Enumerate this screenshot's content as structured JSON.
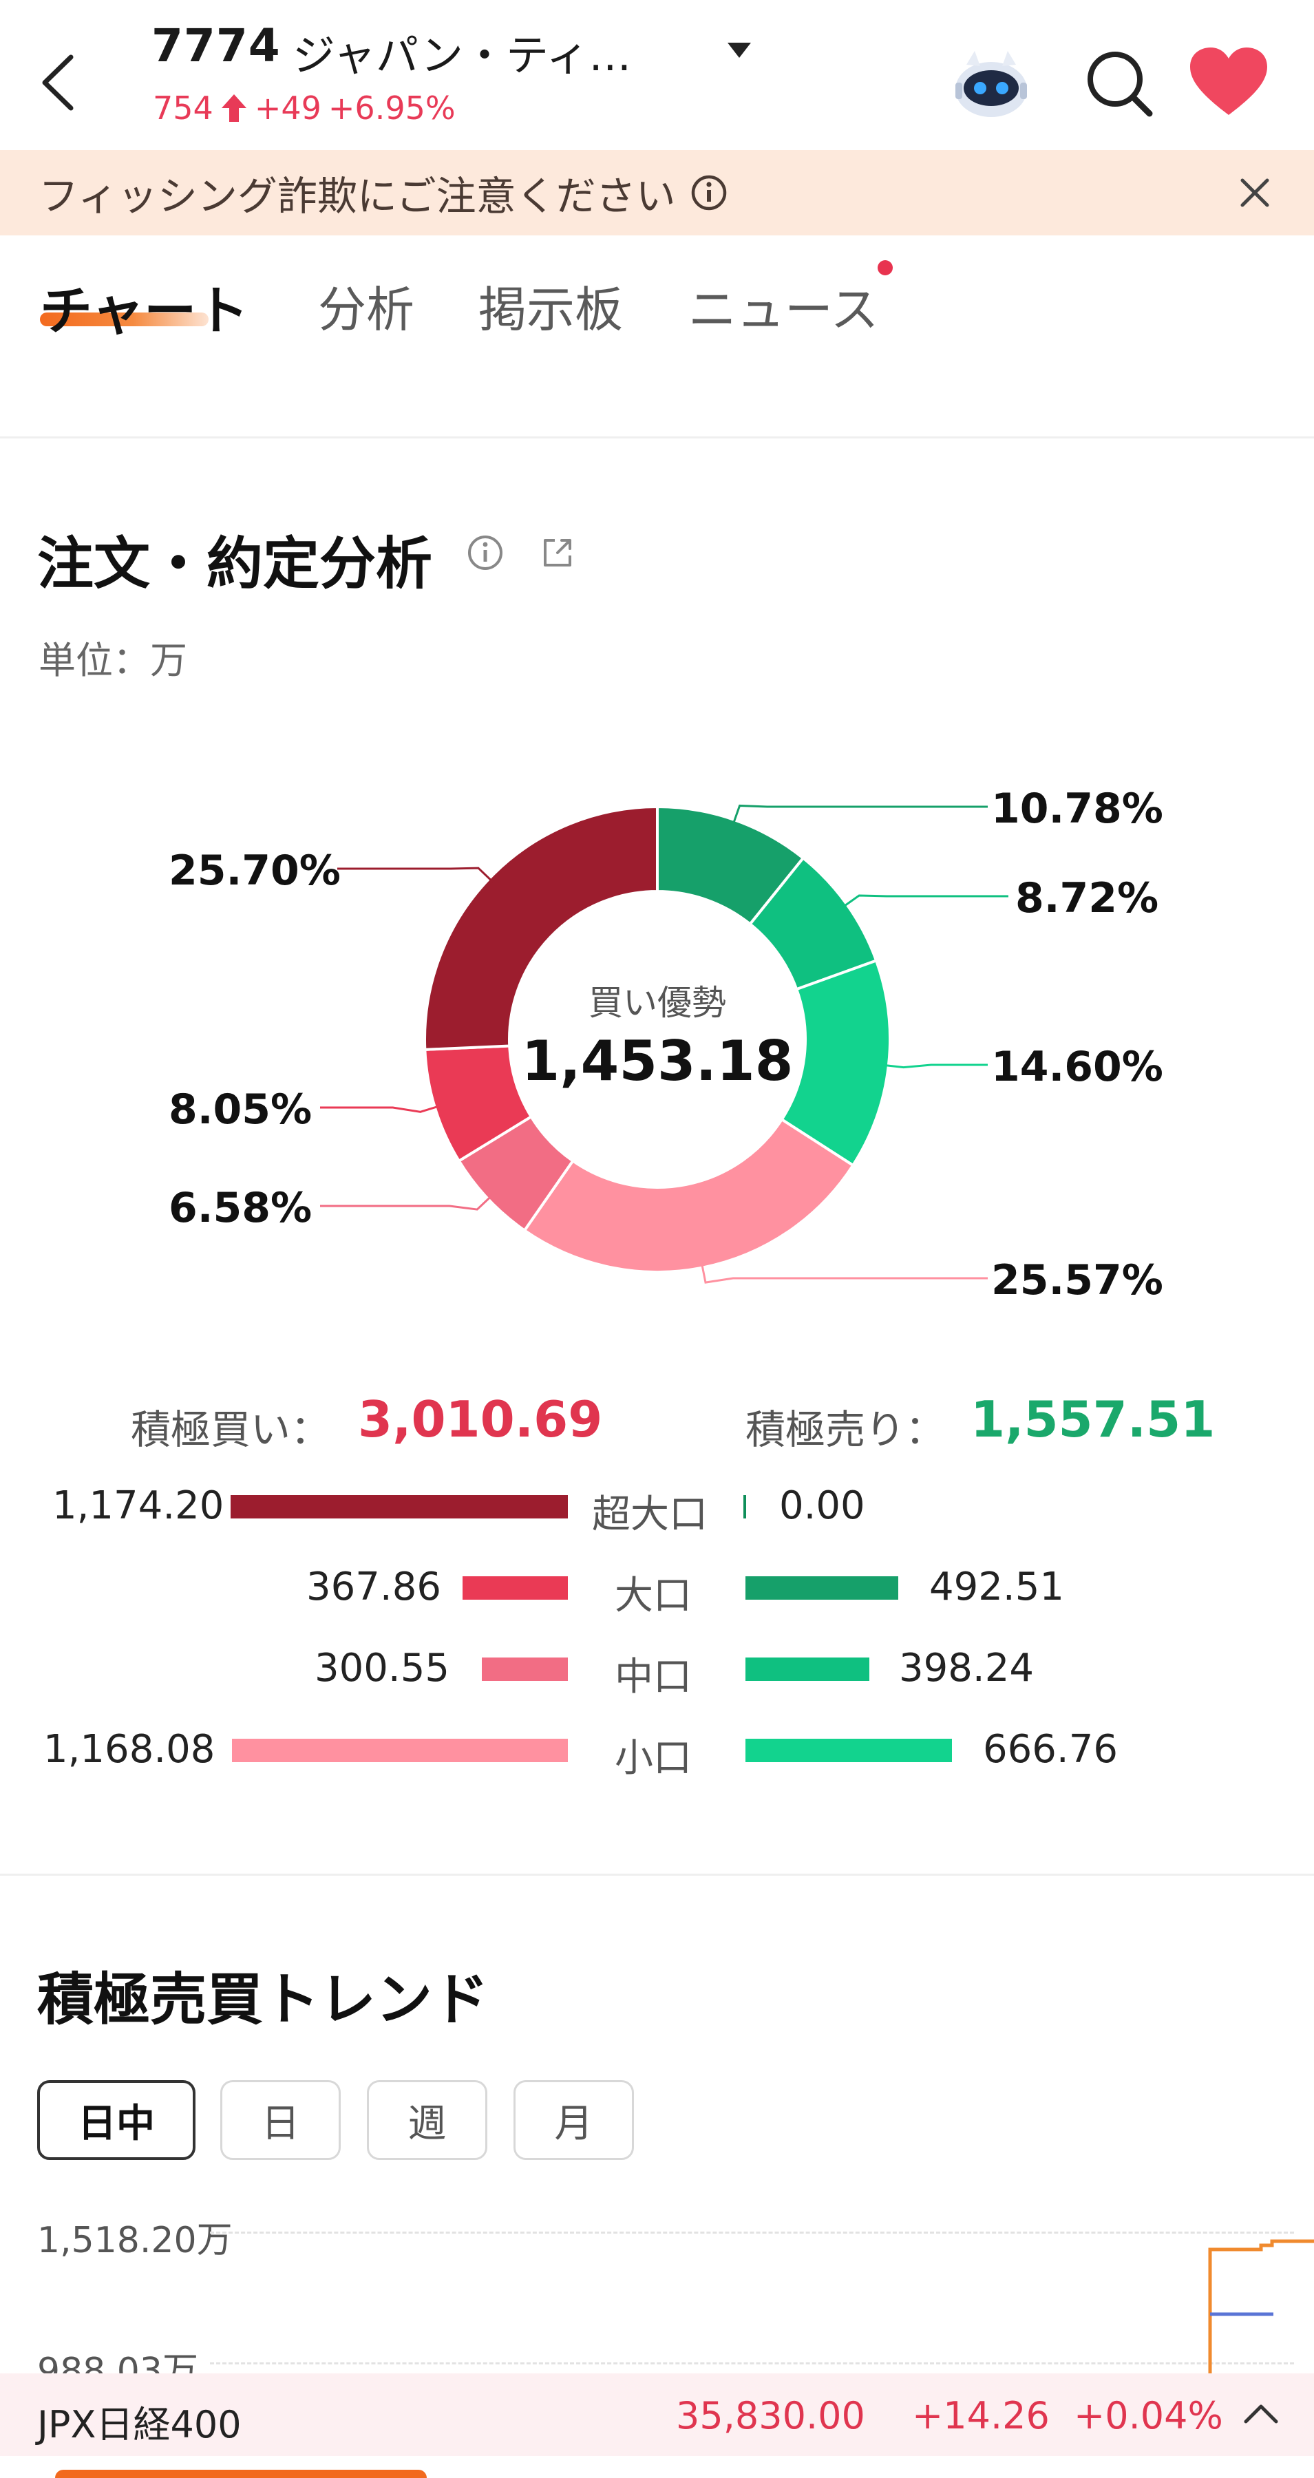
{
  "header": {
    "code": "7774",
    "name": "ジャパン・ティ…",
    "price": "754",
    "change": "+49",
    "change_pct": "+6.95%",
    "accent_color": "#e83a57"
  },
  "warning": {
    "text": "フィッシング詐欺にご注意ください"
  },
  "tabs": [
    {
      "label": "チャート"
    },
    {
      "label": "分析"
    },
    {
      "label": "掲示板"
    },
    {
      "label": "ニュース"
    }
  ],
  "order_analysis": {
    "title": "注文・約定分析",
    "unit": "単位：万",
    "center_label": "買い優勢",
    "center_value": "1,453.18",
    "buy_label": "積極買い：",
    "buy_total": "3,010.69",
    "sell_label": "積極売り：",
    "sell_total": "1,557.51",
    "rows": [
      {
        "category": "超大口",
        "buy": "1,174.20",
        "sell": "0.00"
      },
      {
        "category": "大口",
        "buy": "367.86",
        "sell": "492.51"
      },
      {
        "category": "中口",
        "buy": "300.55",
        "sell": "398.24"
      },
      {
        "category": "小口",
        "buy": "1,168.08",
        "sell": "666.76"
      }
    ]
  },
  "chart_data": {
    "type": "pie",
    "categories": [
      "売り超大口",
      "売り大口",
      "売り中口",
      "売り小口",
      "買い小口",
      "買い中口",
      "買い大口",
      "買い超大口"
    ],
    "values": [
      0.0,
      10.78,
      8.72,
      14.6,
      25.57,
      6.58,
      8.05,
      25.7
    ],
    "labels": [
      "",
      "10.78%",
      "8.72%",
      "14.60%",
      "25.57%",
      "6.58%",
      "8.05%",
      "25.70%"
    ],
    "colors": [
      "#0f8f5a",
      "#16a06a",
      "#0fc080",
      "#12d38e",
      "#ff91a0",
      "#f26d84",
      "#ea3a55",
      "#9c1d2e"
    ]
  },
  "trend": {
    "title": "積極売買トレンド",
    "periods": [
      {
        "label": "日中",
        "active": true
      },
      {
        "label": "日",
        "active": false
      },
      {
        "label": "週",
        "active": false
      },
      {
        "label": "月",
        "active": false
      }
    ],
    "y_top": "1,518.20万",
    "y_bottom": "988.03万"
  },
  "index_bar": {
    "name": "JPX日経400",
    "price": "35,830.00",
    "change": "+14.26",
    "change_pct": "+0.04%"
  }
}
